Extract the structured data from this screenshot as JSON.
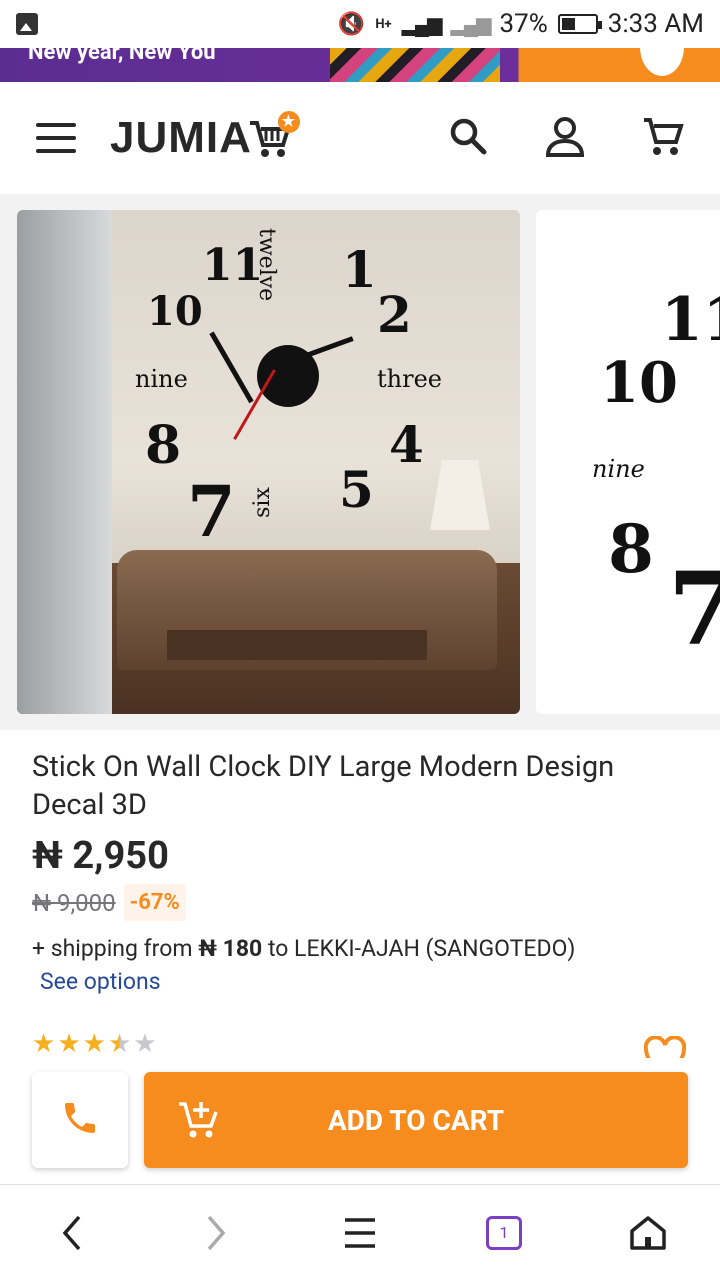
{
  "status_bar": {
    "battery": "37%",
    "time": "3:33 AM",
    "signal_text": "H+"
  },
  "promo": {
    "text": "New year, New You"
  },
  "header": {
    "logo_text": "JUMIA"
  },
  "product": {
    "title": "Stick On Wall Clock DIY Large Modern Design Decal 3D",
    "price": "₦ 2,950",
    "old_price": "₦ 9,000",
    "discount": "-67%",
    "shipping_prefix": "+ shipping from",
    "shipping_amount": "₦ 180",
    "shipping_suffix": "to LEKKI-AJAH (SANGOTEDO)",
    "see_options": "See options",
    "rating": 3.5,
    "rating_max": 5
  },
  "actions": {
    "add_to_cart": "ADD TO CART"
  },
  "browser_nav": {
    "tab_count": "1"
  },
  "colors": {
    "accent": "#f68b1e",
    "link": "#264996",
    "tabs": "#7b3fc4"
  }
}
